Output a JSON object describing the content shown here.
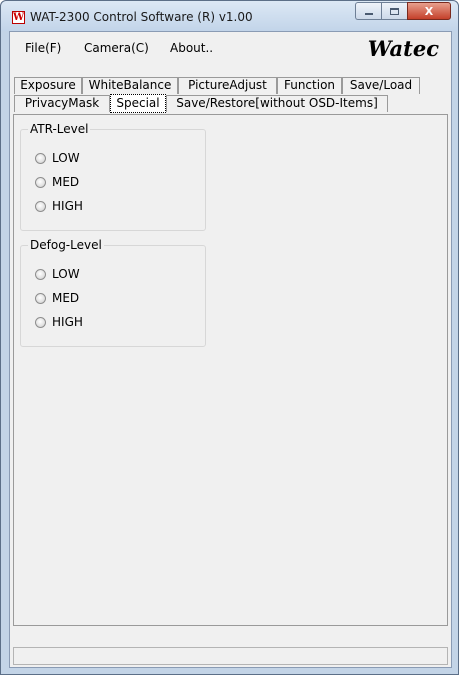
{
  "window": {
    "title": "WAT-2300 Control Software (R) v1.00",
    "icon": "watec-app-icon",
    "icon_letter": "W",
    "buttons": {
      "minimize": "minimize-icon",
      "maximize": "maximize-icon",
      "close": "X"
    }
  },
  "menu": {
    "items": [
      {
        "label": "File(F)"
      },
      {
        "label": "Camera(C)"
      },
      {
        "label": "About.."
      }
    ],
    "logo_text": "Watec"
  },
  "tabs": {
    "row1": [
      "Exposure",
      "WhiteBalance",
      "PictureAdjust",
      "Function",
      "Save/Load"
    ],
    "row2": [
      "PrivacyMask",
      "Special",
      "Save/Restore[without OSD-Items]"
    ],
    "active": "Special"
  },
  "groups": [
    {
      "title": "ATR-Level",
      "options": [
        "LOW",
        "MED",
        "HIGH"
      ],
      "selected": null
    },
    {
      "title": "Defog-Level",
      "options": [
        "LOW",
        "MED",
        "HIGH"
      ],
      "selected": null
    }
  ],
  "status_bar": {
    "text": ""
  }
}
